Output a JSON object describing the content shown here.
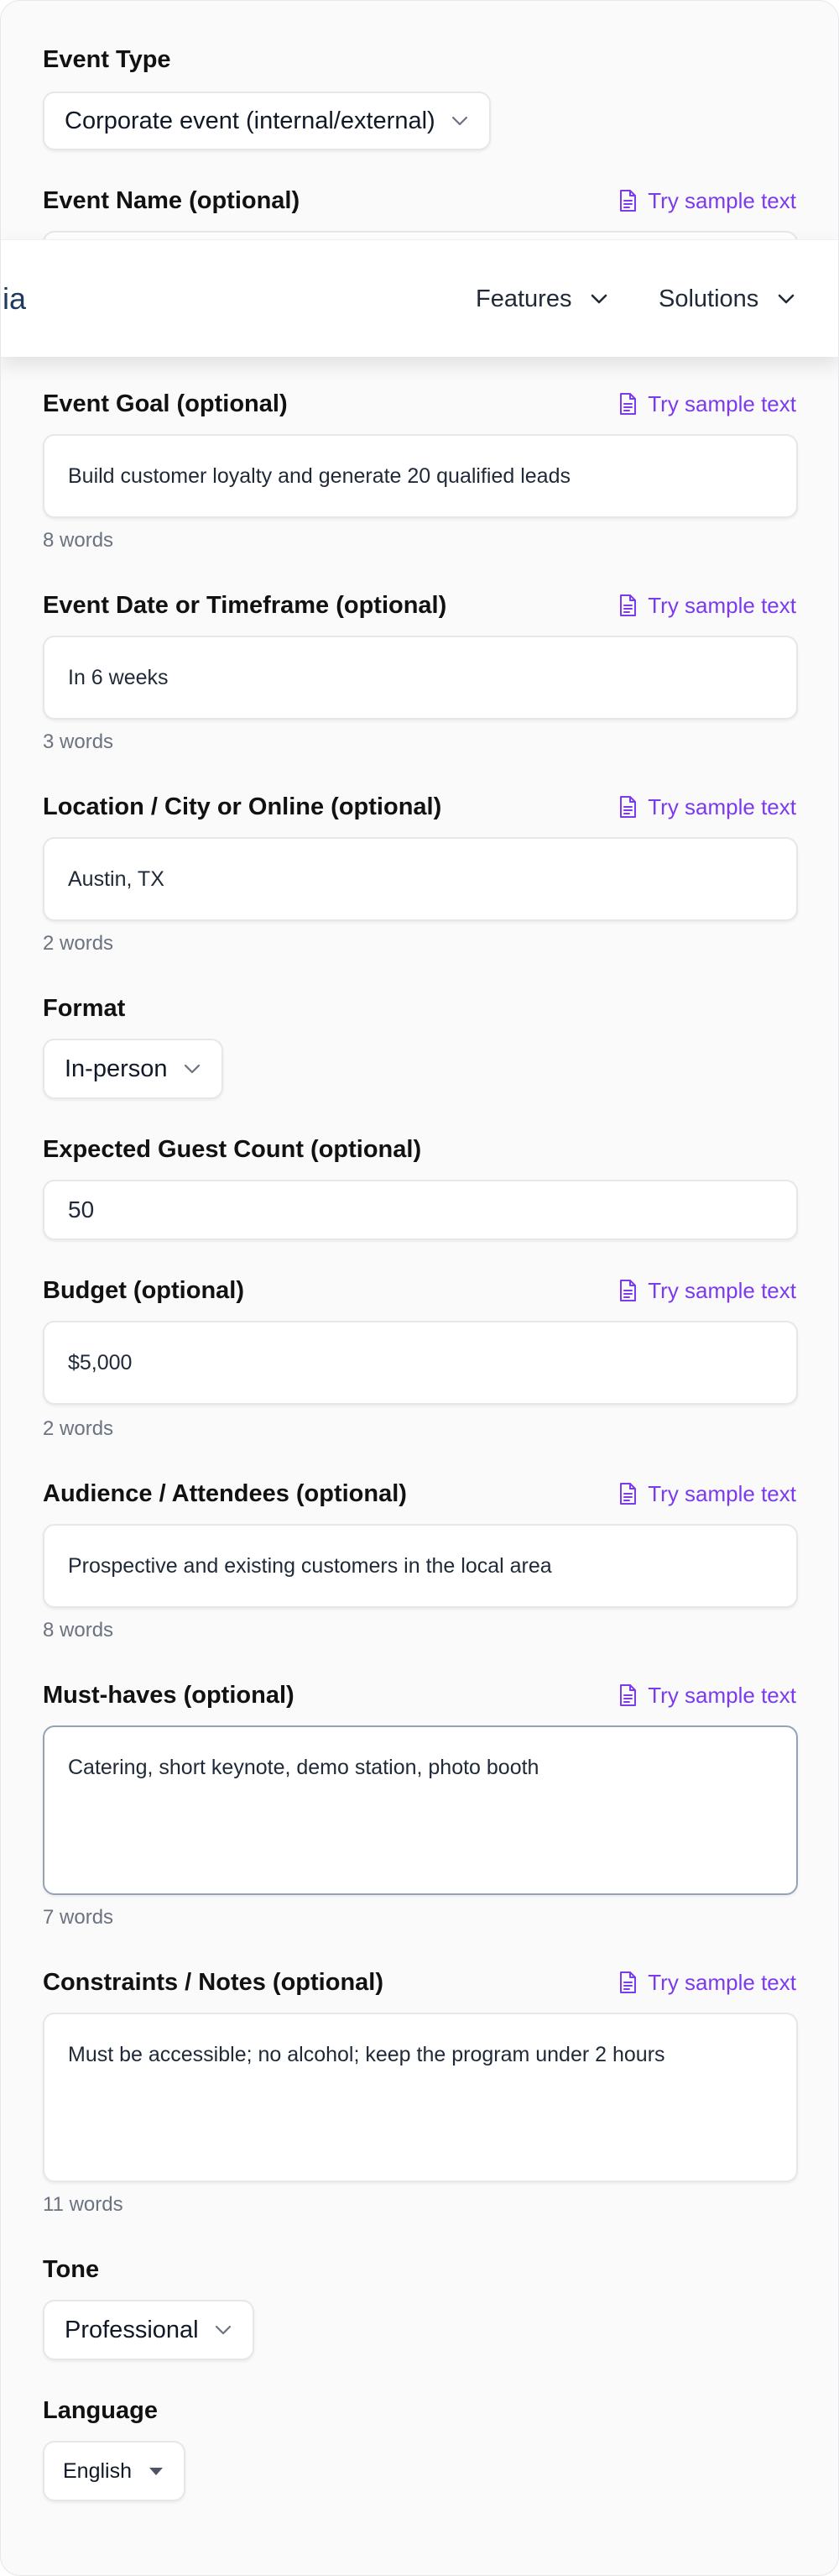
{
  "sample_text_label": "Try sample text",
  "event_type": {
    "label": "Event Type",
    "value": "Corporate event (internal/external)"
  },
  "event_name": {
    "label": "Event Name (optional)"
  },
  "nav": {
    "logo_fragment": "ia",
    "features": "Features",
    "solutions": "Solutions"
  },
  "event_goal": {
    "label": "Event Goal (optional)",
    "value": "Build customer loyalty and generate 20 qualified leads",
    "count": "8 words"
  },
  "event_date": {
    "label": "Event Date or Timeframe (optional)",
    "value": "In 6 weeks",
    "count": "3 words"
  },
  "location": {
    "label": "Location / City or Online (optional)",
    "value": "Austin, TX",
    "count": "2 words"
  },
  "format": {
    "label": "Format",
    "value": "In-person"
  },
  "guest_count": {
    "label": "Expected Guest Count (optional)",
    "value": "50"
  },
  "budget": {
    "label": "Budget (optional)",
    "value": "$5,000",
    "count": "2 words"
  },
  "audience": {
    "label": "Audience / Attendees (optional)",
    "value": "Prospective and existing customers in the local area",
    "count": "8 words"
  },
  "must_haves": {
    "label": "Must-haves (optional)",
    "value": "Catering, short keynote, demo station, photo booth",
    "count": "7 words"
  },
  "constraints": {
    "label": "Constraints / Notes (optional)",
    "value": "Must be accessible; no alcohol; keep the program under 2 hours",
    "count": "11 words"
  },
  "tone": {
    "label": "Tone",
    "value": "Professional"
  },
  "language": {
    "label": "Language",
    "value": "English"
  },
  "colors": {
    "accent": "#7c3aed",
    "text": "#111111",
    "muted": "#6b7280",
    "border": "#e5e7eb"
  }
}
